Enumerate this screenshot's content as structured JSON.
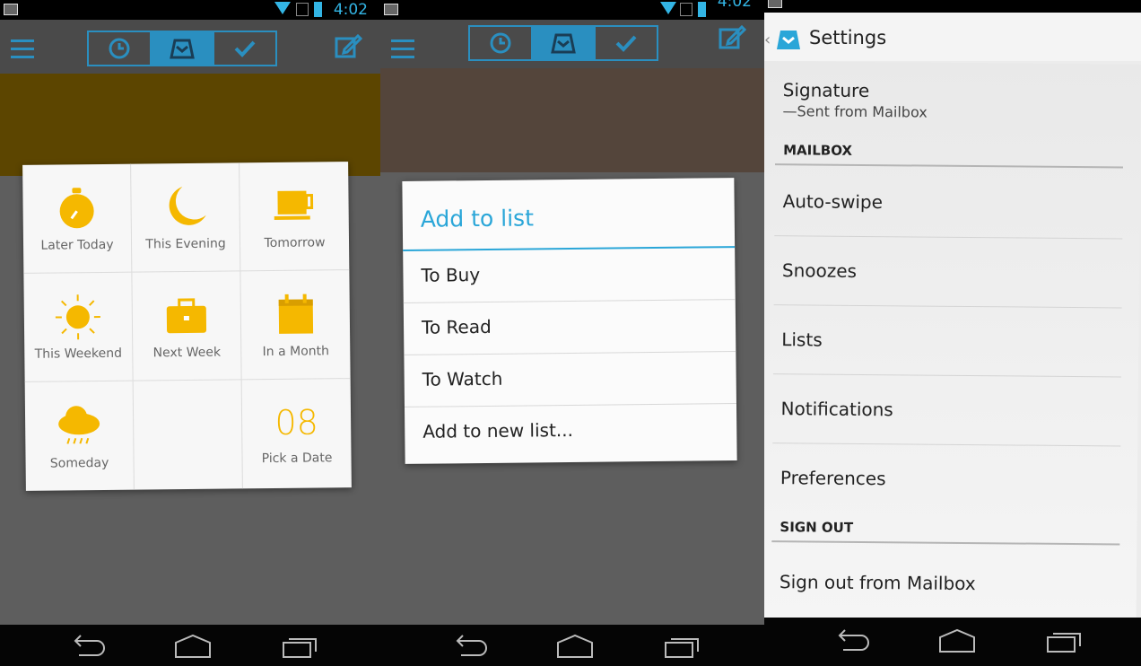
{
  "status_bar": {
    "time": "4:02"
  },
  "colors": {
    "accent_blue": "#2a8fc0",
    "snooze_yellow": "#f5b800",
    "dialog_blue": "#2aa6d8"
  },
  "screen1": {
    "top_tabs": [
      "clock-icon",
      "inbox-icon",
      "checkmark-icon"
    ],
    "banner_color": "#5c4500",
    "snooze_options": [
      {
        "label": "Later Today",
        "icon": "stopwatch-icon"
      },
      {
        "label": "This Evening",
        "icon": "moon-icon"
      },
      {
        "label": "Tomorrow",
        "icon": "coffee-cup-icon"
      },
      {
        "label": "This Weekend",
        "icon": "sun-icon"
      },
      {
        "label": "Next Week",
        "icon": "briefcase-icon"
      },
      {
        "label": "In a Month",
        "icon": "calendar-icon"
      },
      {
        "label": "Someday",
        "icon": "rain-cloud-icon"
      },
      {
        "label": "",
        "icon": ""
      },
      {
        "label": "Pick a Date",
        "date": "08"
      }
    ]
  },
  "screen2": {
    "banner_color": "#54453b",
    "dialog": {
      "title": "Add to list",
      "items": [
        "To Buy",
        "To Read",
        "To Watch",
        "Add to new list..."
      ]
    }
  },
  "screen3": {
    "title": "Settings",
    "signature": {
      "title": "Signature",
      "value": "—Sent from Mailbox"
    },
    "sections": [
      {
        "header": "MAILBOX",
        "items": [
          "Auto-swipe",
          "Snoozes",
          "Lists",
          "Notifications",
          "Preferences"
        ]
      },
      {
        "header": "SIGN OUT",
        "items": [
          "Sign out from Mailbox"
        ]
      }
    ]
  }
}
